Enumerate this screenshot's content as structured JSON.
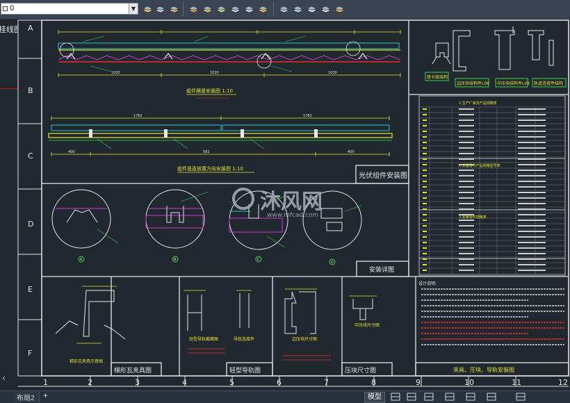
{
  "toolbar": {
    "layer_value": "0",
    "buttons": [
      "layer-properties-icon",
      "layer-previous-icon",
      "layer-state-icon",
      "match-layer-icon",
      "layer-isolate-icon",
      "layer-unisolate-icon",
      "layer-freeze-icon",
      "layer-off-icon",
      "layer-lock-icon",
      "layer-unlock-icon",
      "layer-walk-icon",
      "copy-objects-to-layer-icon",
      "merge-layer-icon",
      "delete-layer-icon"
    ]
  },
  "left_panel": {
    "label": "挂线图"
  },
  "drawing": {
    "row_labels": [
      "A",
      "B",
      "C",
      "D",
      "E",
      "F"
    ],
    "col_labels": [
      "1",
      "2",
      "3",
      "4",
      "5",
      "6",
      "7",
      "8",
      "9",
      "10",
      "11",
      "12"
    ],
    "panels": {
      "section1_title": "组件横竖安装图 1:10",
      "section2_title": "组件竖直放置方向安装图 1:10",
      "pv_install_title": "光伏组件安装图",
      "detail_title": "安装详图",
      "tile_clamp_title": "梯形瓦夹具图",
      "rail_title": "轻型导轨图",
      "press_block_title": "压块尺寸图",
      "title_block": "夹具、压块、导轨安装图"
    },
    "part_labels": {
      "p1": "搭卡接结构",
      "p2": "边压块结构件L08",
      "p3": "中压块结构件L08",
      "p4": "轨道连接件结构",
      "clamp": "梯形瓦夹具示意图",
      "rail_a": "轻型导轨截面图",
      "rail_b": "导轨连接件",
      "press_a": "边压块尺寸图",
      "press_b": "中压块尺寸图"
    },
    "dims": {
      "d1": "1020",
      "d2": "1020",
      "d3": "1020",
      "d4": "1762",
      "d5": "1762",
      "d6": "400",
      "d7": "582",
      "d8": "400"
    },
    "circle_labels": [
      "A",
      "B",
      "C",
      "D"
    ],
    "table_headers": [
      "1.生产厂家及产品规格表",
      "2.安装零件产品规格型号表",
      "3.安装零件规格表"
    ],
    "notes_title": "设计说明:",
    "watermark": {
      "brand": "沐风网",
      "url": "www.mfcad.com"
    }
  },
  "status": {
    "tabs": [
      "布局2"
    ],
    "add_tab": "+",
    "model_button": "模型",
    "icons": [
      "grid-icon",
      "snap-icon",
      "ortho-icon",
      "polar-icon",
      "osnap-icon",
      "annotate-icon",
      "workspace-icon"
    ]
  },
  "colors": {
    "bg": "#212830",
    "frame": "#e8e8e8",
    "yellow": "#e5e52e",
    "cyan": "#27c7d1",
    "green": "#3fd64a",
    "magenta": "#d637d6",
    "red": "#e23030"
  }
}
